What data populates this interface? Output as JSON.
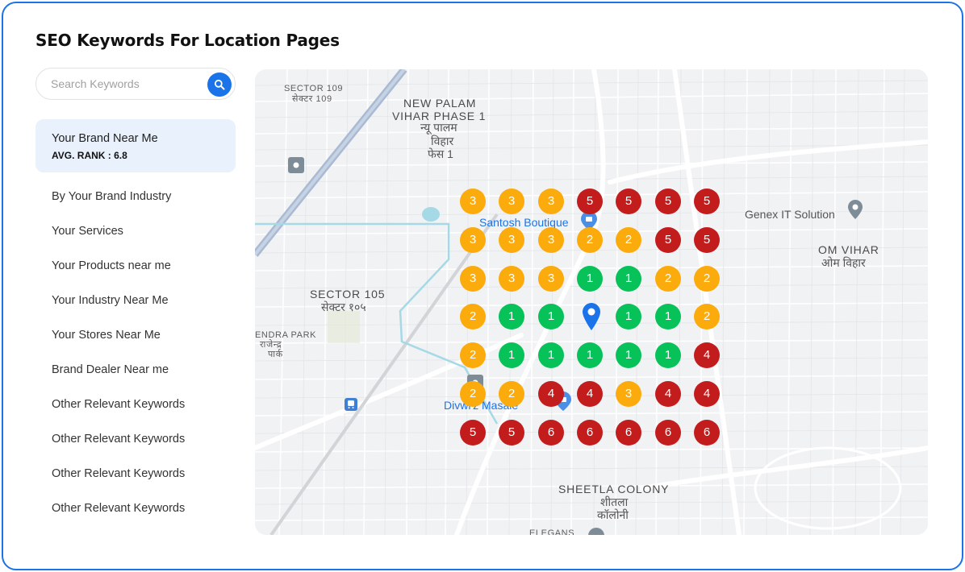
{
  "page": {
    "title": "SEO Keywords For Location Pages"
  },
  "search": {
    "placeholder": "Search Keywords",
    "icon": "search-icon"
  },
  "keywords": {
    "active": {
      "label": "Your Brand Near Me",
      "rank_text": "AVG. RANK : 6.8"
    },
    "items": [
      "By Your Brand Industry",
      "Your Services",
      "Your Products near me",
      "Your Industry Near Me",
      "Your Stores Near Me",
      "Brand Dealer Near me",
      "Other Relevant Keywords",
      "Other Relevant Keywords",
      "Other Relevant Keywords",
      "Other Relevant Keywords"
    ]
  },
  "map": {
    "places": {
      "sector109_en": "SECTOR 109",
      "sector109_hi": "सेक्टर 109",
      "newpalam_en1": "NEW PALAM",
      "newpalam_en2": "VIHAR PHASE 1",
      "newpalam_hi1": "न्यू पालम",
      "newpalam_hi2": "विहार",
      "newpalam_hi3": "फेस 1",
      "santosh": "Santosh Boutique",
      "genex": "Genex IT Solution",
      "omvihar_en": "OM VIHAR",
      "omvihar_hi": "ओम विहार",
      "sector105_en": "SECTOR 105",
      "sector105_hi": "सेक्टर १०५",
      "rajendra_en": "ENDRA PARK",
      "rajendra_hi1": "राजेन्द्र",
      "rajendra_hi2": "पार्क",
      "divwiz": "Divwi'z Masale",
      "sheetla_en": "SHEETLA COLONY",
      "sheetla_hi1": "शीतला",
      "sheetla_hi2": "कॉलोनी",
      "elegans": "ELEGANS"
    },
    "rank_grid": [
      [
        3,
        3,
        3,
        5,
        5,
        5,
        5
      ],
      [
        3,
        3,
        3,
        2,
        2,
        5,
        5
      ],
      [
        3,
        3,
        3,
        1,
        1,
        2,
        2
      ],
      [
        2,
        1,
        1,
        null,
        1,
        1,
        2
      ],
      [
        2,
        1,
        1,
        1,
        1,
        1,
        4
      ],
      [
        2,
        2,
        4,
        4,
        3,
        4,
        4
      ],
      [
        5,
        5,
        6,
        6,
        6,
        6,
        6
      ]
    ],
    "rank_colors": {
      "good": "#06c258",
      "medium": "#fbab0c",
      "poor": "#c21c1c"
    },
    "center_marker": "location-pin-icon"
  }
}
